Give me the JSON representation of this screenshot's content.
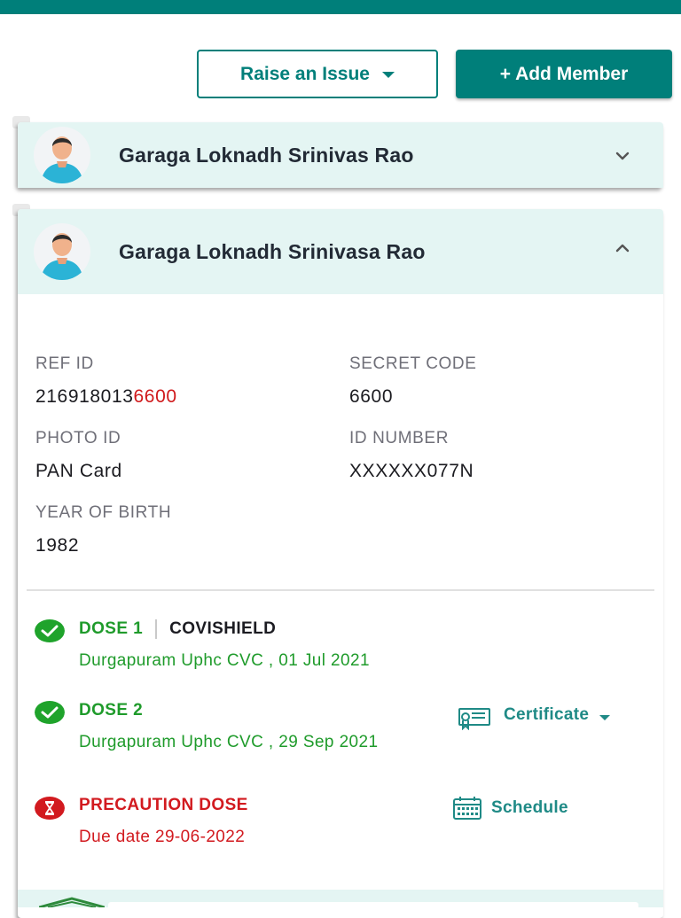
{
  "actions": {
    "raise_issue_label": "Raise an Issue",
    "add_member_label": "+ Add Member"
  },
  "members": [
    {
      "name": "Garaga Loknadh Srinivas Rao",
      "expanded": false
    },
    {
      "name": "Garaga Loknadh Srinivasa Rao",
      "expanded": true,
      "details": {
        "ref_id_label": "REF ID",
        "ref_id_prefix": "21691801З",
        "ref_id_prefix_clean": "216918013",
        "ref_id_suffix": "6600",
        "secret_code_label": "SECRET CODE",
        "secret_code": "6600",
        "photo_id_label": "PHOTO ID",
        "photo_id": "PAN Card",
        "id_number_label": "ID NUMBER",
        "id_number": "XXXXXX077N",
        "yob_label": "YEAR OF BIRTH",
        "yob": "1982"
      },
      "doses": {
        "dose1": {
          "label": "DOSE 1",
          "vaccine": "COVISHIELD",
          "info": "Durgapuram Uphc CVC , 01 Jul 2021"
        },
        "dose2": {
          "label": "DOSE 2",
          "info": "Durgapuram Uphc CVC , 29 Sep 2021",
          "certificate_label": "Certificate"
        },
        "precaution": {
          "label": "PRECAUTION DOSE",
          "info": "Due date 29-06-2022",
          "schedule_label": "Schedule"
        }
      }
    }
  ],
  "colors": {
    "brand": "#007f7a",
    "header_bg": "#e4f5f3",
    "success": "#1f9b2b",
    "danger": "#d21a1f"
  },
  "icons": {
    "avatar": "user-avatar-icon",
    "expand": "chevron-down-icon",
    "collapse": "chevron-up-icon",
    "completed": "check-circle-icon",
    "pending": "hourglass-icon",
    "certificate": "certificate-icon",
    "schedule": "calendar-icon"
  }
}
